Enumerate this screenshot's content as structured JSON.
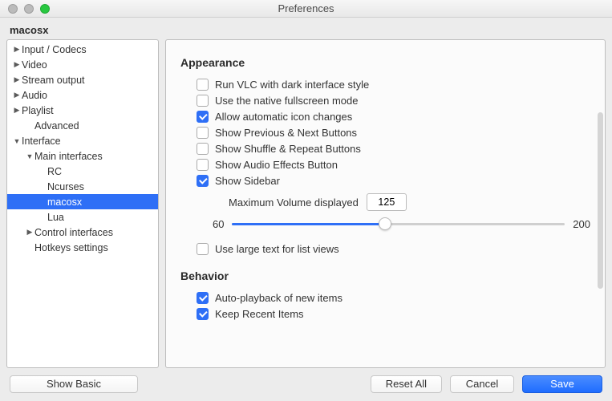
{
  "window": {
    "title": "Preferences",
    "current_panel": "macosx"
  },
  "sidebar": {
    "items": [
      {
        "label": "Input / Codecs",
        "depth": 0,
        "arrow": "right"
      },
      {
        "label": "Video",
        "depth": 0,
        "arrow": "right"
      },
      {
        "label": "Stream output",
        "depth": 0,
        "arrow": "right"
      },
      {
        "label": "Audio",
        "depth": 0,
        "arrow": "right"
      },
      {
        "label": "Playlist",
        "depth": 0,
        "arrow": "right"
      },
      {
        "label": "Advanced",
        "depth": 1,
        "arrow": ""
      },
      {
        "label": "Interface",
        "depth": 0,
        "arrow": "down"
      },
      {
        "label": "Main interfaces",
        "depth": 1,
        "arrow": "down"
      },
      {
        "label": "RC",
        "depth": 2,
        "arrow": ""
      },
      {
        "label": "Ncurses",
        "depth": 2,
        "arrow": ""
      },
      {
        "label": "macosx",
        "depth": 2,
        "arrow": "",
        "selected": true
      },
      {
        "label": "Lua",
        "depth": 2,
        "arrow": ""
      },
      {
        "label": "Control interfaces",
        "depth": 1,
        "arrow": "right"
      },
      {
        "label": "Hotkeys settings",
        "depth": 1,
        "arrow": ""
      }
    ]
  },
  "appearance": {
    "title": "Appearance",
    "checks": [
      {
        "label": "Run VLC with dark interface style",
        "checked": false
      },
      {
        "label": "Use the native fullscreen mode",
        "checked": false
      },
      {
        "label": "Allow automatic icon changes",
        "checked": true
      },
      {
        "label": "Show Previous & Next Buttons",
        "checked": false
      },
      {
        "label": "Show Shuffle & Repeat Buttons",
        "checked": false
      },
      {
        "label": "Show Audio Effects Button",
        "checked": false
      },
      {
        "label": "Show Sidebar",
        "checked": true
      }
    ],
    "volume_label": "Maximum Volume displayed",
    "volume_value": "125",
    "slider_min": "60",
    "slider_max": "200",
    "slider_pct": 46,
    "large_text": {
      "label": "Use large text for list views",
      "checked": false
    }
  },
  "behavior": {
    "title": "Behavior",
    "checks": [
      {
        "label": "Auto-playback of new items",
        "checked": true
      },
      {
        "label": "Keep Recent Items",
        "checked": true
      }
    ]
  },
  "footer": {
    "show_basic": "Show Basic",
    "reset_all": "Reset All",
    "cancel": "Cancel",
    "save": "Save"
  }
}
